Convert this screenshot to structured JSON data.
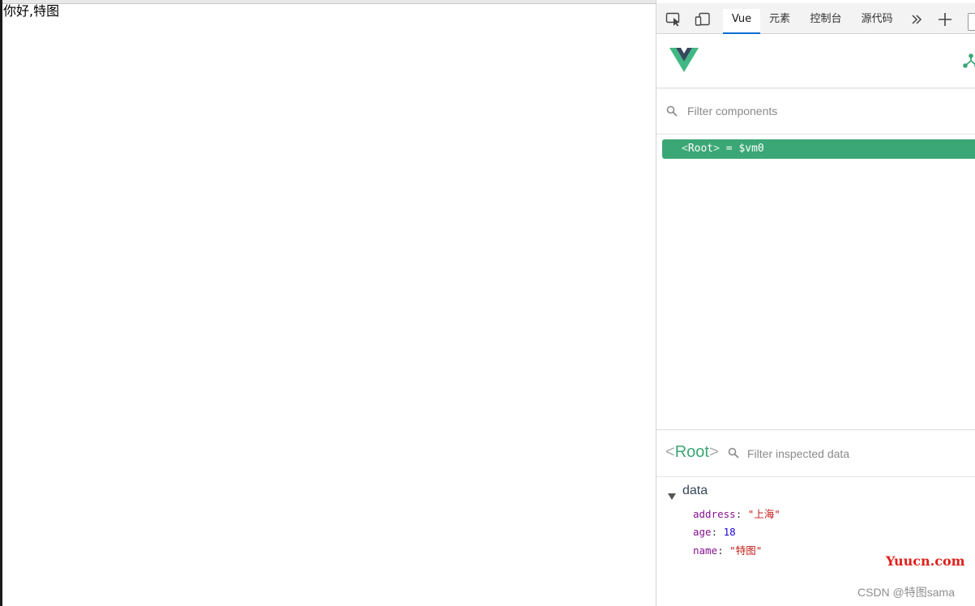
{
  "page": {
    "text": "你好,特图"
  },
  "devtools": {
    "tabs": [
      {
        "label": "Vue",
        "active": true
      },
      {
        "label": "元素",
        "active": false
      },
      {
        "label": "控制台",
        "active": false
      },
      {
        "label": "源代码",
        "active": false
      }
    ],
    "toolbar_icons": [
      "inspect-element-icon",
      "device-emulation-icon",
      "more-tabs-icon",
      "add-tab-icon"
    ]
  },
  "vue": {
    "logo": "vue-logo",
    "components_filter": {
      "placeholder": "Filter components"
    },
    "tree": {
      "root_open": "<",
      "root_name": "Root",
      "root_close": ">",
      "root_suffix": " = $vm0"
    },
    "inspector": {
      "title_open": "<",
      "title_name": "Root",
      "title_close": ">",
      "filter_placeholder": "Filter inspected data",
      "section_label": "data",
      "props": [
        {
          "key": "address",
          "value": "\"上海\"",
          "type": "string"
        },
        {
          "key": "age",
          "value": "18",
          "type": "number"
        },
        {
          "key": "name",
          "value": "\"特图\"",
          "type": "string"
        }
      ]
    },
    "colors": {
      "accent": "#3ba776",
      "tab_underline": "#0a6dd6"
    }
  },
  "watermarks": {
    "site": "Yuucn.com",
    "author": "CSDN @特图sama"
  }
}
